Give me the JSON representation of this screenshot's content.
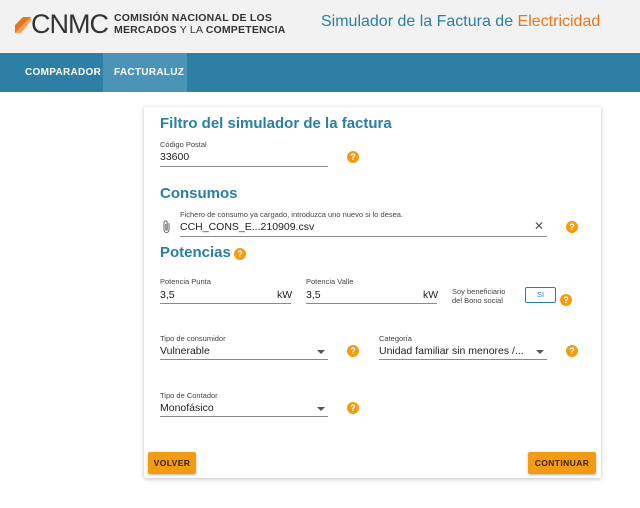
{
  "brand": {
    "logo_letters": "CNMC",
    "logo_line1": "COMISIÓN NACIONAL DE LOS",
    "logo_line2_bold": "MERCADOS",
    "logo_line2_thin": " Y LA ",
    "logo_line2_end": "COMPETENCIA",
    "colors": {
      "orange": "#e8751a",
      "blue": "#2a7fa3"
    }
  },
  "header": {
    "title_main": "Simulador de la Factura de ",
    "title_accent": "Electricidad"
  },
  "nav": {
    "items": [
      {
        "label": "COMPARADOR",
        "active": false
      },
      {
        "label": "FACTURALUZ",
        "active": true
      }
    ]
  },
  "form": {
    "filter_title": "Filtro del simulador de la factura",
    "postal_label": "Código Postal",
    "postal_value": "33600",
    "consumos_title": "Consumos",
    "file_hint": "Fichero de consumo ya cargado, introduzca uno nuevo si lo desea.",
    "file_name": "CCH_CONS_E...210909.csv",
    "potencias_title": "Potencias",
    "punta_label": "Potencia Punta",
    "punta_value": "3,5",
    "punta_unit": "kW",
    "valle_label": "Potencia Valle",
    "valle_value": "3,5",
    "valle_unit": "kW",
    "bono_label_1": "Soy beneficiario",
    "bono_label_2": "del Bono social",
    "bono_button": "SI",
    "consumidor_label": "Tipo de consumidor",
    "consumidor_value": "Vulnerable",
    "categoria_label": "Categoría",
    "categoria_value": "Unidad familiar sin menores /...",
    "contador_label": "Tipo de Contador",
    "contador_value": "Monofásico",
    "help_glyph": "?",
    "clear_glyph": "✕",
    "attach_icon": "paperclip-icon"
  },
  "actions": {
    "back_label": "VOLVER",
    "continue_label": "CONTINUAR"
  }
}
